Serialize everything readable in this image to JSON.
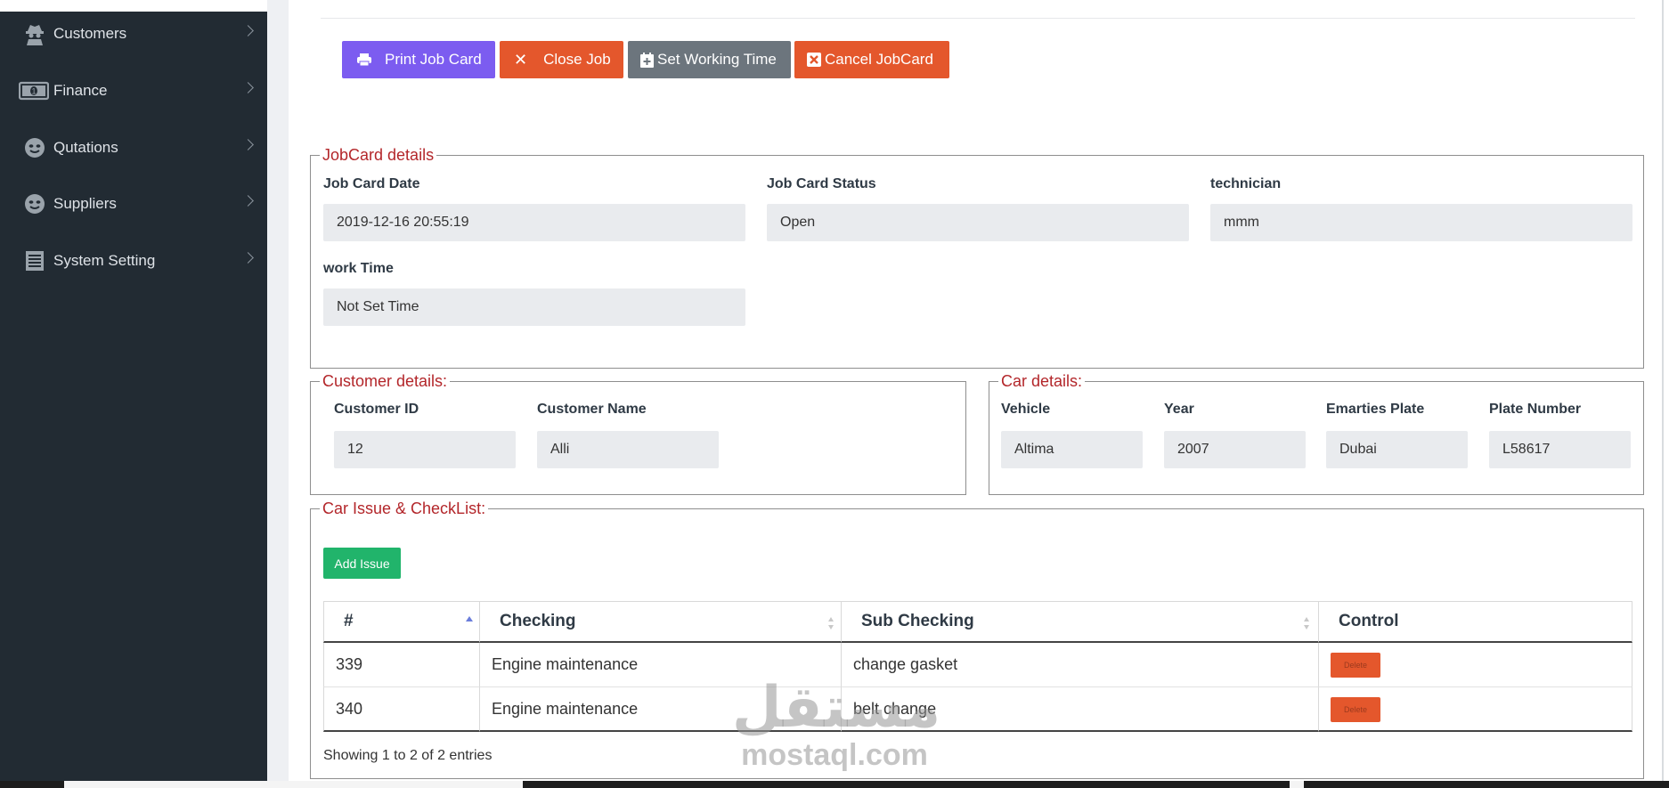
{
  "sidebar": {
    "items": [
      {
        "label": "Customers",
        "icon": "spy-icon"
      },
      {
        "label": "Finance",
        "icon": "money-icon"
      },
      {
        "label": "Qutations",
        "icon": "smile-icon"
      },
      {
        "label": "Suppliers",
        "icon": "smile-icon"
      },
      {
        "label": "System Setting",
        "icon": "list-icon"
      }
    ]
  },
  "actions": {
    "print": "Print Job Card",
    "close": "Close Job",
    "set_time": "Set Working Time",
    "cancel": "Cancel JobCard"
  },
  "jobcard": {
    "legend": "JobCard details",
    "date_label": "Job Card Date",
    "date_value": "2019-12-16 20:55:19",
    "status_label": "Job Card Status",
    "status_value": "Open",
    "tech_label": "technician",
    "tech_value": "mmm",
    "work_label": "work Time",
    "work_value": "Not Set Time"
  },
  "customer": {
    "legend": "Customer details:",
    "id_label": "Customer ID",
    "id_value": "12",
    "name_label": "Customer Name",
    "name_value": "Alli"
  },
  "car": {
    "legend": "Car details:",
    "vehicle_label": "Vehicle",
    "vehicle_value": "Altima",
    "year_label": "Year",
    "year_value": "2007",
    "plate_region_label": "Emarties Plate",
    "plate_region_value": "Dubai",
    "plate_label": "Plate Number",
    "plate_value": "L58617"
  },
  "issues": {
    "legend": "Car Issue & CheckList:",
    "add_label": "Add Issue",
    "columns": [
      "#",
      "Checking",
      "Sub Checking",
      "Control"
    ],
    "rows": [
      {
        "id": "339",
        "checking": "Engine maintenance",
        "sub": "change gasket",
        "action": "Delete"
      },
      {
        "id": "340",
        "checking": "Engine maintenance",
        "sub": "belt change",
        "action": "Delete"
      }
    ],
    "info": "Showing 1 to 2 of 2 entries"
  },
  "watermark": {
    "arabic": "مستقل",
    "latin": "mostaql.com"
  },
  "colors": {
    "sidebar_bg": "#222b33",
    "purple": "#7c5cf0",
    "danger": "#e4572c",
    "secondary": "#6c757d",
    "success": "#21b46b",
    "legend": "#b3262a"
  }
}
